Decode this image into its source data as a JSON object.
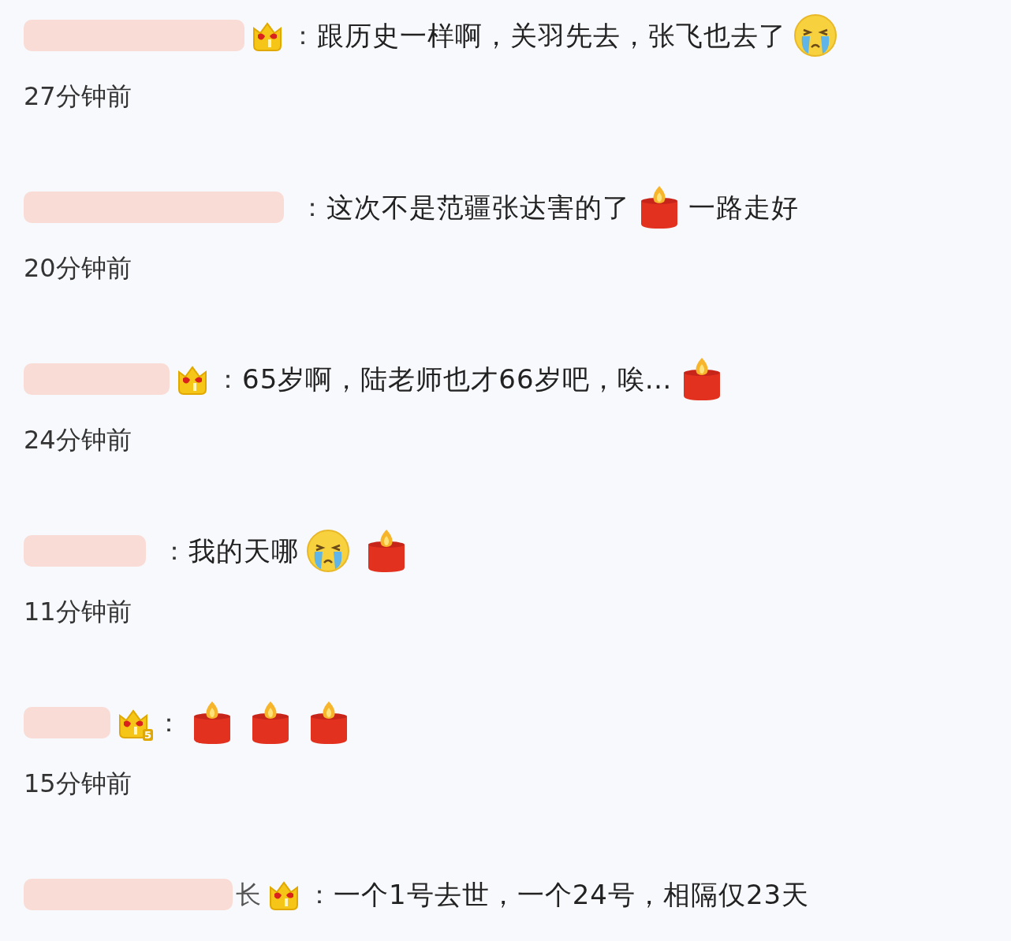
{
  "comments": [
    {
      "badge": {
        "kind": "crown"
      },
      "separator": "：",
      "content": [
        {
          "kind": "text",
          "text": "跟历史一样啊，关羽先去，张飞也去了"
        },
        {
          "kind": "cry"
        }
      ],
      "time": "27分钟前"
    },
    {
      "separator": "：",
      "content": [
        {
          "kind": "text",
          "text": "这次不是范疆张达害的了"
        },
        {
          "kind": "candle"
        },
        {
          "kind": "text",
          "text": "一路走好"
        }
      ],
      "time": "20分钟前"
    },
    {
      "badge": {
        "kind": "crown"
      },
      "separator": "：",
      "content": [
        {
          "kind": "text",
          "text": "65岁啊，陆老师也才66岁吧，唉…"
        },
        {
          "kind": "candle"
        }
      ],
      "time": "24分钟前"
    },
    {
      "separator": "：",
      "content": [
        {
          "kind": "text",
          "text": "我的天哪"
        },
        {
          "kind": "cry"
        },
        {
          "kind": "candle"
        }
      ],
      "time": "11分钟前"
    },
    {
      "badge": {
        "kind": "crown",
        "label": "5"
      },
      "separator": "：",
      "content": [
        {
          "kind": "candle"
        },
        {
          "kind": "candle"
        },
        {
          "kind": "candle"
        }
      ],
      "time": "15分钟前"
    },
    {
      "name_tail": "长",
      "badge": {
        "kind": "crown"
      },
      "separator": "：",
      "content": [
        {
          "kind": "text",
          "text": "一个1号去世，一个24号，相隔仅23天"
        }
      ]
    }
  ]
}
